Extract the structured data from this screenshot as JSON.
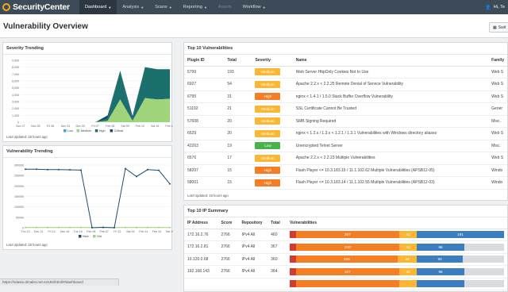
{
  "app": {
    "name": "SecurityCenter"
  },
  "nav": {
    "items": [
      {
        "label": "Dashboard",
        "active": true
      },
      {
        "label": "Analysis"
      },
      {
        "label": "Scans"
      },
      {
        "label": "Reporting"
      },
      {
        "label": "Assets"
      },
      {
        "label": "Workflow"
      }
    ],
    "user": "Hi, Te"
  },
  "page": {
    "title": "Vulnerability Overview",
    "switch_label": "Swit"
  },
  "severity_trending": {
    "title": "Severity Trending",
    "footer": "Last Updated: 18 hours ago",
    "chart_data": {
      "type": "area",
      "categories": [
        "Nov 27",
        "Nov 29",
        "Dec 01",
        "Dec 03",
        "Dec 05",
        "Dec 07",
        "Feb 08",
        "Feb 09",
        "Feb 11",
        "Feb 13",
        "Feb 15",
        "Feb 17",
        "Feb 19"
      ],
      "x_ticks": [
        "Nov 27",
        "Nov 28",
        "Fri 06",
        "Dec 03",
        "Dec 05",
        "Fri 07",
        "Feb 08",
        "Sat 09",
        "Feb 12",
        "Sat 16",
        "Feb 18"
      ],
      "ylim": [
        0,
        9000
      ],
      "y_ticks": [
        "9,000",
        "8,000",
        "7,000",
        "6,000",
        "5,000",
        "4,000",
        "3,000",
        "2,000",
        "1,000",
        "0"
      ],
      "series": [
        {
          "name": "Low",
          "color": "#4a9fd6",
          "values": [
            0,
            0,
            0,
            0,
            0,
            0,
            0,
            0,
            0,
            0,
            0,
            0,
            0
          ]
        },
        {
          "name": "Medium",
          "color": "#9fd47b",
          "values": [
            0,
            0,
            0,
            0,
            0,
            0,
            0,
            200,
            3300,
            200,
            3500,
            3300,
            3400
          ]
        },
        {
          "name": "High",
          "color": "#1b6f6d",
          "values": [
            0,
            0,
            0,
            0,
            0,
            0,
            0,
            300,
            4200,
            300,
            4500,
            4400,
            4300
          ]
        },
        {
          "name": "Critical",
          "color": "#0f4e6c",
          "values": [
            0,
            0,
            0,
            0,
            0,
            0,
            0,
            500,
            0,
            400,
            0,
            0,
            0
          ]
        }
      ]
    }
  },
  "vuln_trending": {
    "title": "Vulnerability Trending",
    "footer": "Last Updated: 18 hours ago",
    "chart_data": {
      "type": "line",
      "x_ticks": [
        "Thu 10",
        "Dec 12",
        "Fri 14",
        "Dec 16",
        "Tue 18",
        "Feb 08",
        "Feb 07",
        "Fri 13",
        "Sat 09",
        "Feb 14",
        "Feb 15",
        "Sat 19"
      ],
      "ylim": [
        0,
        300000
      ],
      "y_ticks": [
        "300000",
        "250000",
        "200000",
        "150000",
        "100000",
        "50000",
        "0"
      ],
      "series": [
        {
          "name": "New",
          "color": "#1e4b6e",
          "values": [
            280000,
            280000,
            278000,
            278000,
            277000,
            276000,
            0,
            2000,
            0,
            283000,
            245000,
            278000,
            275000,
            210000
          ]
        },
        {
          "name": "Old",
          "color": "#9fd47b",
          "values": [
            1000,
            1000,
            1000,
            1000,
            1000,
            1000,
            1000,
            1000,
            1000,
            1000,
            1000,
            1000,
            1000,
            1000
          ]
        }
      ]
    }
  },
  "top10_vulns": {
    "title": "Top 10 Vulnerabilities",
    "footer": "Last Updated: 18 hours ago",
    "columns": [
      "Plugin ID",
      "Total",
      "Severity",
      "Name",
      "Family"
    ],
    "rows": [
      {
        "plugin": "5799",
        "total": "193",
        "severity": "Medium",
        "name": "Web Server HttpOnly Cookies Not In Use",
        "family": "Web S"
      },
      {
        "plugin": "6927",
        "total": "54",
        "severity": "Medium",
        "name": "Apache 2.2.x < 2.2.25 Remote Denial of Service Vulnerability",
        "family": "Web S"
      },
      {
        "plugin": "6795",
        "total": "31",
        "severity": "High",
        "name": "nginx < 1.4.1 / 1.5.0 Stack Buffer Overflow Vulnerability",
        "family": "Web S"
      },
      {
        "plugin": "51192",
        "total": "21",
        "severity": "Medium",
        "name": "SSL Certificate Cannot Be Trusted",
        "family": "Gener"
      },
      {
        "plugin": "57608",
        "total": "20",
        "severity": "Medium",
        "name": "SMB Signing Required",
        "family": "Misc."
      },
      {
        "plugin": "6529",
        "total": "20",
        "severity": "Medium",
        "name": "nginx < 1.2.x / 1.3.x < 1.2.1 / 1.3.1 Vulnerabilities with Windows directory aliases",
        "family": "Web S"
      },
      {
        "plugin": "42263",
        "total": "19",
        "severity": "Low",
        "name": "Unencrypted Telnet Server",
        "family": "Misc."
      },
      {
        "plugin": "6576",
        "total": "17",
        "severity": "Medium",
        "name": "Apache 2.2.x < 2.2.23 Multiple Vulnerabilities",
        "family": "Web S"
      },
      {
        "plugin": "58207",
        "total": "15",
        "severity": "High",
        "name": "Flash Player <= 10.3.183.15 / 11.1.102.62 Multiple Vulnerabilities (APSB12-05)",
        "family": "Windo"
      },
      {
        "plugin": "58001",
        "total": "15",
        "severity": "High",
        "name": "Flash Player <= 10.3.183.14 / 11.1.102.55 Multiple Vulnerabilities (APSB12-03)",
        "family": "Windo"
      }
    ]
  },
  "top10_ips": {
    "title": "Top 10 IP Summary",
    "columns": [
      "IP Address",
      "Score",
      "Repository",
      "Total",
      "Vulnerabilities"
    ],
    "rows": [
      {
        "ip": "172.16.2.76",
        "score": "2766",
        "repo": "IPv4 All",
        "total": "460",
        "bars": [
          {
            "v": "",
            "w": 8,
            "c": "#d43a2f"
          },
          {
            "v": "207",
            "w": 130,
            "c": "#f57e25"
          },
          {
            "v": "41",
            "w": 22,
            "c": "#fbb731"
          },
          {
            "v": "191",
            "w": 110,
            "c": "#3b7dbf"
          }
        ]
      },
      {
        "ip": "172.16.2.81",
        "score": "2766",
        "repo": "IPv4 All",
        "total": "367",
        "bars": [
          {
            "v": "",
            "w": 8,
            "c": "#d43a2f"
          },
          {
            "v": "210",
            "w": 130,
            "c": "#f57e25"
          },
          {
            "v": "41",
            "w": 22,
            "c": "#fbb731"
          },
          {
            "v": "96",
            "w": 60,
            "c": "#3b7dbf"
          },
          {
            "v": "",
            "w": 50,
            "c": "#d9dcdf"
          }
        ]
      },
      {
        "ip": "10.120.0.68",
        "score": "2766",
        "repo": "IPv4 All",
        "total": "360",
        "bars": [
          {
            "v": "",
            "w": 8,
            "c": "#d43a2f"
          },
          {
            "v": "205",
            "w": 128,
            "c": "#f57e25"
          },
          {
            "v": "44",
            "w": 24,
            "c": "#fbb731"
          },
          {
            "v": "93",
            "w": 58,
            "c": "#3b7dbf"
          },
          {
            "v": "",
            "w": 52,
            "c": "#d9dcdf"
          }
        ]
      },
      {
        "ip": "192.168.143",
        "score": "2766",
        "repo": "IPv4 All",
        "total": "364",
        "bars": [
          {
            "v": "",
            "w": 8,
            "c": "#d43a2f"
          },
          {
            "v": "207",
            "w": 130,
            "c": "#f57e25"
          },
          {
            "v": "41",
            "w": 22,
            "c": "#fbb731"
          },
          {
            "v": "96",
            "w": 60,
            "c": "#3b7dbf"
          },
          {
            "v": "",
            "w": 50,
            "c": "#d9dcdf"
          }
        ]
      },
      {
        "ip": "",
        "score": "",
        "repo": "",
        "total": "",
        "bars": [
          {
            "v": "",
            "w": 8,
            "c": "#d43a2f"
          },
          {
            "v": "",
            "w": 130,
            "c": "#f57e25"
          },
          {
            "v": "",
            "w": 22,
            "c": "#fbb731"
          },
          {
            "v": "",
            "w": 60,
            "c": "#3b7dbf"
          },
          {
            "v": "",
            "w": 50,
            "c": "#d9dcdf"
          }
        ]
      }
    ]
  },
  "status_bar": {
    "url": "https://sdasio.dmailer.net:44194/html/#/dashboard"
  }
}
